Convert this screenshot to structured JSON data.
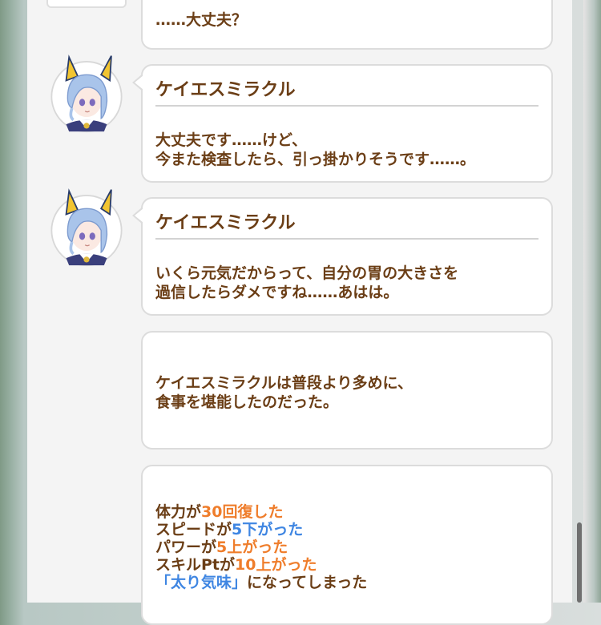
{
  "prev_message": {
    "text": "……大丈夫？"
  },
  "messages": [
    {
      "speaker": "ケイエスミラクル",
      "lines": [
        "大丈夫です……けど、",
        "今また検査したら、引っ掛かりそうです……。"
      ]
    },
    {
      "speaker": "ケイエスミラクル",
      "lines": [
        "いくら元気だからって、自分の胃の大きさを",
        "過信したらダメですね……あはは。"
      ]
    }
  ],
  "narration": {
    "lines": [
      "ケイエスミラクルは普段より多めに、",
      "食事を堪能したのだった。"
    ]
  },
  "results": {
    "stamina": {
      "prefix": "体力が",
      "value": "30",
      "suffix": "回復した"
    },
    "speed": {
      "prefix": "スピードが",
      "value": "5",
      "suffix": "下がった"
    },
    "power": {
      "prefix": "パワーが",
      "value": "5",
      "suffix": "上がった"
    },
    "skill_pt": {
      "prefix": "スキルPtが",
      "value": "10",
      "suffix": "上がった"
    },
    "condition": {
      "status": "「太り気味」",
      "suffix": "になってしまった"
    }
  },
  "colors": {
    "text_brown": "#6b3e16",
    "increase_orange": "#ef7d2b",
    "decrease_blue": "#3f86e2",
    "bubble_border": "#dcdcdc"
  },
  "icons": {
    "avatar": "character-avatar-icon"
  }
}
